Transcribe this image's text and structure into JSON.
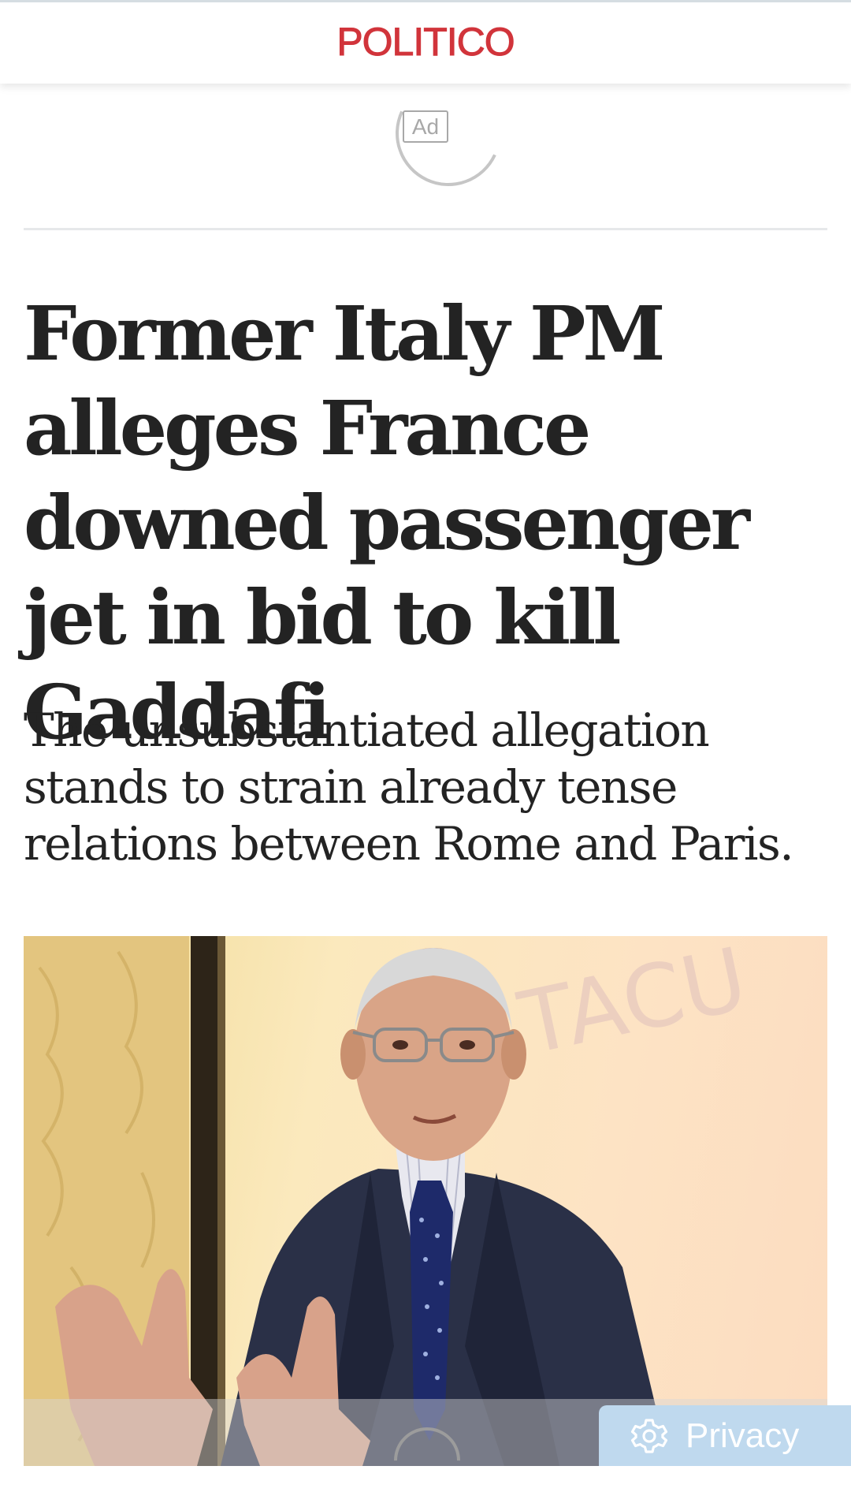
{
  "header": {
    "logo_text": "POLITICO",
    "logo_color": "#d1343b"
  },
  "ad": {
    "label": "Ad"
  },
  "article": {
    "headline": "Former Italy PM alleges France downed passenger jet in bid to kill Gaddafi",
    "dek": "The unsubstantiated allegation stands to strain already tense relations between Rome and Paris."
  },
  "photo": {
    "background_text": "TACU"
  },
  "privacy_button": {
    "label": "Privacy",
    "icon": "gear-icon",
    "background_color": "#bfd9ee"
  }
}
